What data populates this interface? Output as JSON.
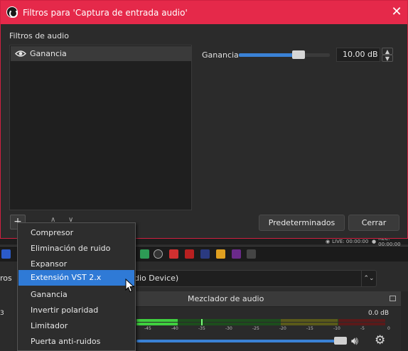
{
  "dialog": {
    "title": "Filtros para 'Captura de entrada audio'",
    "close_glyph": "✕",
    "section_label": "Filtros de audio",
    "filters": [
      {
        "name": "Ganancia",
        "icon": "eye-icon"
      }
    ],
    "property": {
      "label": "Ganancia",
      "value": "10.00 dB",
      "slider_level": 0.66
    },
    "buttons": {
      "add": "+",
      "up": "∧",
      "down": "∨",
      "defaults": "Predeterminados",
      "close": "Cerrar"
    }
  },
  "context_menu": {
    "items": [
      "Compresor",
      "Eliminación de ruido",
      "Expansor",
      "Extensión VST 2.x",
      "Ganancia",
      "Invertir polaridad",
      "Limitador",
      "Puerta anti-ruidos"
    ],
    "highlighted_index": 3
  },
  "background": {
    "status": {
      "live": "LIVE: 00:00:00",
      "rec": "REC: 00:00:00"
    },
    "left_label": "ros",
    "combo_value": "dio Device)",
    "combo_arrow": "⌃⌄",
    "mixer_title": "Mezclador de audio",
    "left_value": "3",
    "db_value": "0.0 dB",
    "meter_ticks": [
      "-45",
      "-40",
      "-35",
      "-30",
      "-25",
      "-20",
      "-15",
      "-10",
      "-5",
      "0"
    ],
    "volume_level": 0.95,
    "accent_color": "#e5294a",
    "highlight_color": "#2f7ad6"
  }
}
